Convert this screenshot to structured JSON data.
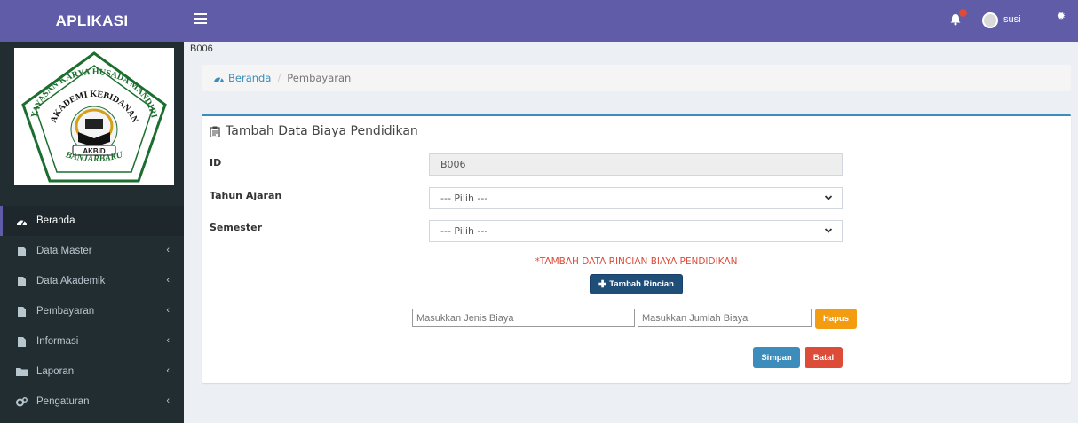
{
  "app": {
    "brand": "APLIKASI",
    "user_name": "susi"
  },
  "page_code": "B006",
  "breadcrumb": {
    "home": "Beranda",
    "current": "Pembayaran"
  },
  "sidebar": {
    "items": [
      {
        "label": "Beranda",
        "icon": "dashboard-icon",
        "active": true
      },
      {
        "label": "Data Master",
        "icon": "file-icon"
      },
      {
        "label": "Data Akademik",
        "icon": "file-icon"
      },
      {
        "label": "Pembayaran",
        "icon": "file-icon"
      },
      {
        "label": "Informasi",
        "icon": "file-icon"
      },
      {
        "label": "Laporan",
        "icon": "folder-icon"
      },
      {
        "label": "Pengaturan",
        "icon": "cogs-icon"
      }
    ]
  },
  "logo": {
    "arc_text": "YAYASAN KARYA HUSADA MANDIRI",
    "inner_text": "AKADEMI KEBIDANAN",
    "badge": "AKBID",
    "bottom_text": "BANJARBARU"
  },
  "form": {
    "title": "Tambah Data Biaya Pendidikan",
    "id_label": "ID",
    "id_value": "B006",
    "tahun_label": "Tahun Ajaran",
    "tahun_value": "--- Pilih ---",
    "semester_label": "Semester",
    "semester_value": "--- Pilih ---",
    "note": "*TAMBAH DATA RINCIAN BIAYA PENDIDIKAN",
    "add_button": "Tambah Rincian",
    "jenis_placeholder": "Masukkan Jenis Biaya",
    "jumlah_placeholder": "Masukkan Jumlah Biaya",
    "hapus_button": "Hapus",
    "simpan_button": "Simpan",
    "batal_button": "Batal"
  },
  "colors": {
    "primary": "#605ca8",
    "sidebar": "#222d32",
    "accent": "#3c8dbc",
    "danger": "#dd4b39",
    "warning": "#f39c12"
  }
}
